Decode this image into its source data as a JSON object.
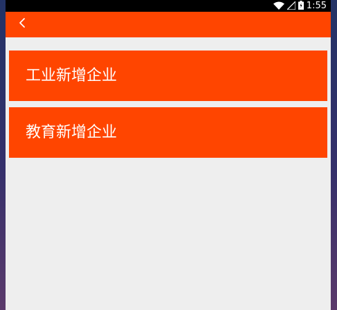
{
  "status_bar": {
    "time": "1:55",
    "icons": [
      "wifi-icon",
      "signal-icon",
      "battery-icon"
    ]
  },
  "app_bar": {
    "back_icon": "chevron-left-icon",
    "color": "#ff4500"
  },
  "list": {
    "items": [
      {
        "label": "工业新增企业"
      },
      {
        "label": "教育新增企业"
      }
    ]
  },
  "colors": {
    "accent": "#ff4500",
    "background": "#eeeeee",
    "status_bar": "#000000"
  }
}
